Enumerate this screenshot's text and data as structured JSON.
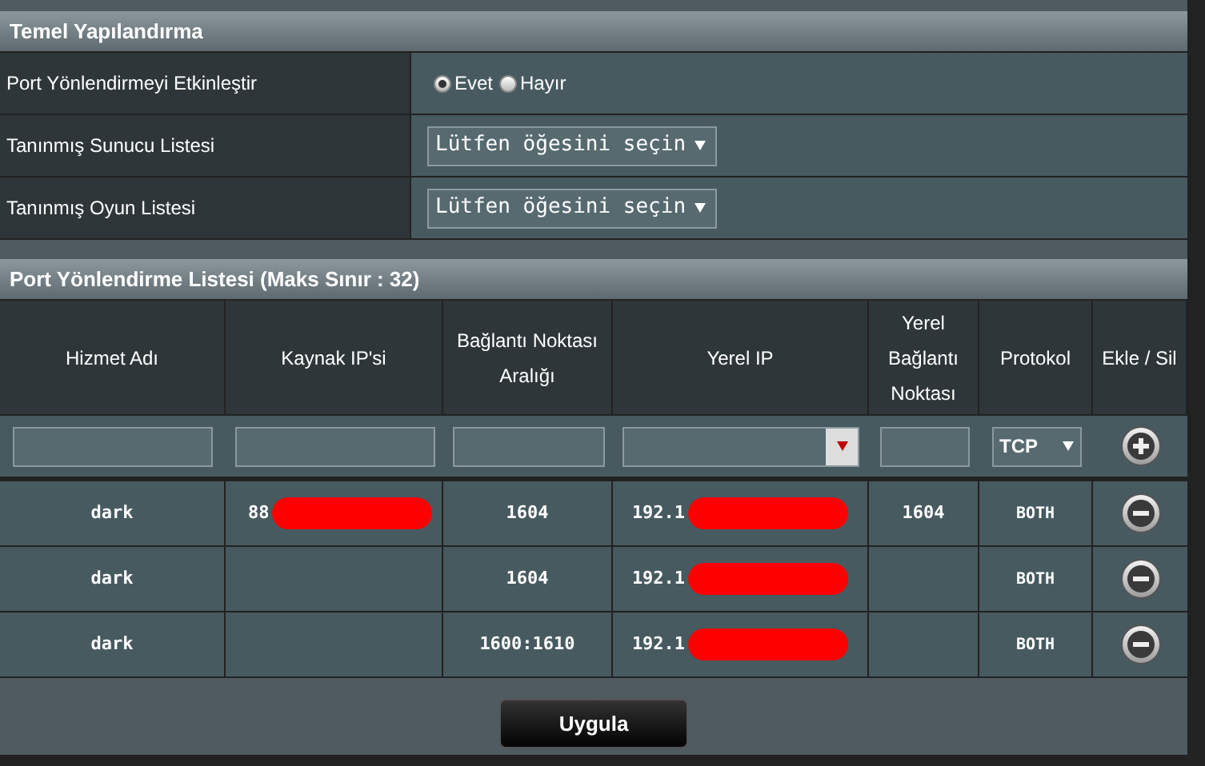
{
  "basic_config": {
    "title": "Temel Yapılandırma",
    "enable_row": {
      "label": "Port Yönlendirmeyi Etkinleştir",
      "options": [
        {
          "label": "Evet",
          "selected": true
        },
        {
          "label": "Hayır",
          "selected": false
        }
      ]
    },
    "selects": [
      {
        "label": "Tanınmış Sunucu Listesi",
        "value": "Lütfen öğesini seçin"
      },
      {
        "label": "Tanınmış Oyun Listesi",
        "value": "Lütfen öğesini seçin"
      }
    ]
  },
  "forward_list": {
    "title": "Port Yönlendirme Listesi (Maks Sınır : 32)",
    "columns": [
      "Hizmet Adı",
      "Kaynak IP'si",
      "Bağlantı Noktası Aralığı",
      "Yerel IP",
      "Yerel Bağlantı Noktası",
      "Protokol",
      "Ekle / Sil"
    ],
    "new_entry": {
      "protocol": "TCP"
    },
    "rows": [
      {
        "service": "dark",
        "source_ip": "88",
        "source_ip_redacted": true,
        "port_range": "1604",
        "local_ip": "192.1",
        "local_ip_redacted": true,
        "local_port": "1604",
        "protocol": "BOTH"
      },
      {
        "service": "dark",
        "source_ip": "",
        "source_ip_redacted": false,
        "port_range": "1604",
        "local_ip": "192.1",
        "local_ip_redacted": true,
        "local_port": "",
        "protocol": "BOTH"
      },
      {
        "service": "dark",
        "source_ip": "",
        "source_ip_redacted": false,
        "port_range": "1600:1610",
        "local_ip": "192.1",
        "local_ip_redacted": true,
        "local_port": "",
        "protocol": "BOTH"
      }
    ]
  },
  "apply_button": "Uygula"
}
